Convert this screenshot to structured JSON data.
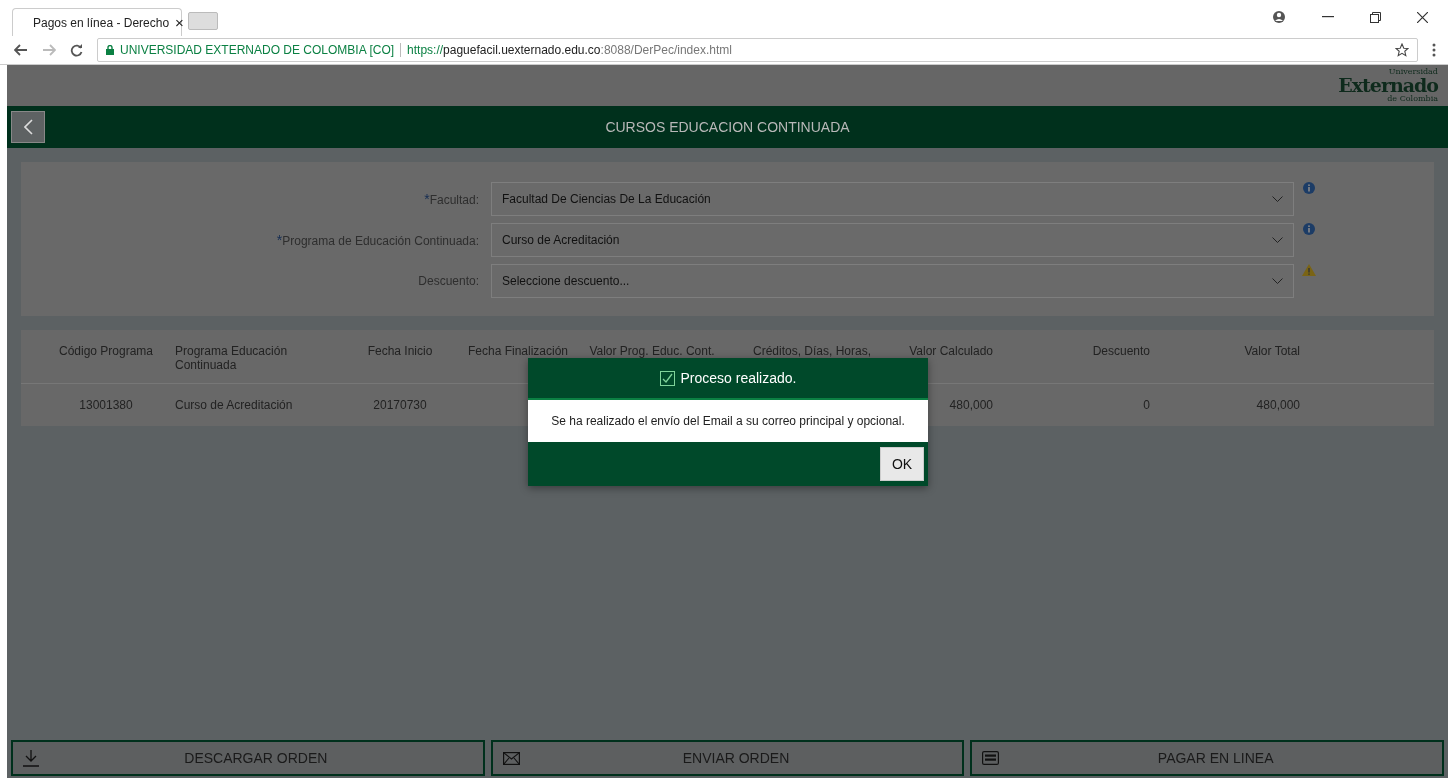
{
  "browser": {
    "tab_title": "Pagos en línea - Derecho",
    "tab_close": "×",
    "site_identity": "UNIVERSIDAD EXTERNADO DE COLOMBIA [CO]",
    "url_scheme": "https://",
    "url_host": "paguefacil.uexternado.edu.co",
    "url_path": ":8088/DerPec/index.html"
  },
  "logo": {
    "top": "Universidad",
    "main": "Externado",
    "bottom": "de Colombia"
  },
  "header": {
    "title": "CURSOS EDUCACION CONTINUADA"
  },
  "form": {
    "fields": [
      {
        "kind": "info",
        "marker": "*",
        "label": "Facultad:",
        "value": "Facultad De Ciencias De La Educación"
      },
      {
        "kind": "info",
        "marker": "*",
        "label": "Programa de Educación Continuada:",
        "value": "Curso de Acreditación"
      },
      {
        "kind": "warning",
        "label": "Descuento:",
        "value": "Seleccione descuento..."
      }
    ]
  },
  "table": {
    "columns": [
      "Código Programa",
      "Programa Educación Continuada",
      "Fecha Inicio",
      "Fecha Finalización",
      "Valor Prog. Educ. Cont.",
      "Créditos, Días, Horas,",
      "Valor Calculado",
      "Descuento",
      "Valor Total"
    ],
    "rows": [
      {
        "cells": [
          "13001380",
          "Curso de Acreditación",
          "20170730",
          null,
          null,
          null,
          "480,000",
          "0",
          "480,000"
        ]
      }
    ]
  },
  "dialog": {
    "title": "Proceso realizado.",
    "message": "Se ha realizado el envío del Email a su correo principal y opcional.",
    "button": "OK"
  },
  "actions": [
    {
      "kind": "download",
      "label": "DESCARGAR ORDEN"
    },
    {
      "kind": "mail",
      "label": "ENVIAR ORDEN"
    },
    {
      "kind": "card",
      "label": "PAGAR EN LINEA"
    }
  ]
}
